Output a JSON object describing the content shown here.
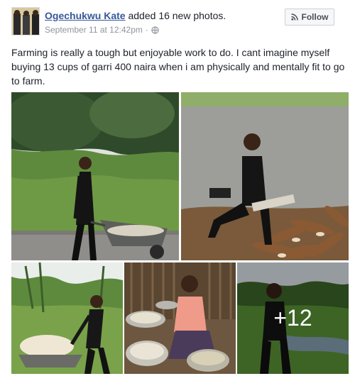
{
  "post": {
    "author": "Ogechukwu Kate",
    "action": " added ",
    "count_text": "16 new photos",
    "period": ".",
    "timestamp": "September 11 at 12:42pm",
    "separator": "·",
    "follow_label": "Follow",
    "text": "Farming is really a tough but enjoyable work to do. I cant imagine myself buying 13 cups of garri 400 naira when i am physically and mentally fit to go to farm.",
    "more_photos_label": "+12"
  },
  "icons": {
    "privacy": "globe-icon",
    "follow": "rss-icon"
  },
  "colors": {
    "link": "#365899",
    "meta": "#90949c",
    "text": "#1d2129"
  }
}
